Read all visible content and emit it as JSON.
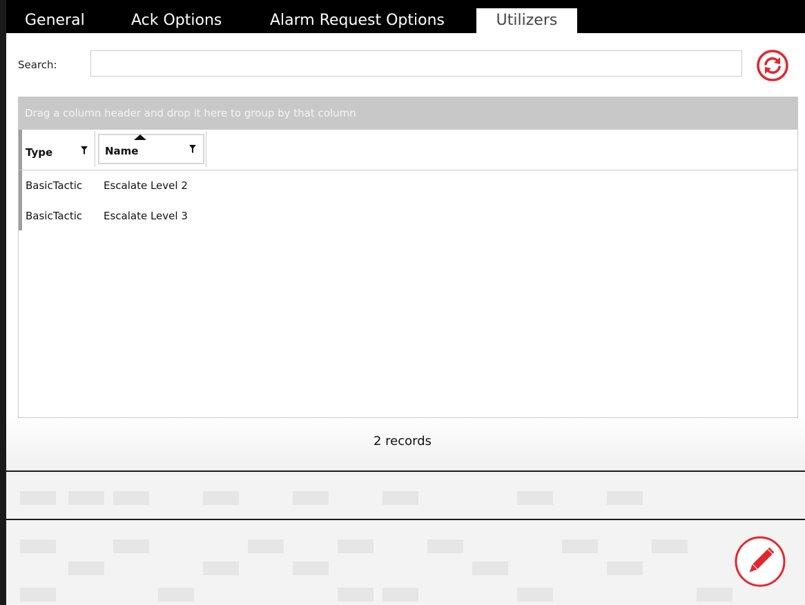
{
  "tabs": [
    {
      "label": "General",
      "active": false
    },
    {
      "label": "Ack Options",
      "active": false
    },
    {
      "label": "Alarm Request Options",
      "active": false
    },
    {
      "label": "Utilizers",
      "active": true
    }
  ],
  "search": {
    "label": "Search:",
    "value": "",
    "placeholder": ""
  },
  "grid": {
    "group_panel_text": "Drag a column header and drop it here to group by that column",
    "columns": [
      {
        "label": "Type",
        "sorted": false
      },
      {
        "label": "Name",
        "sorted": true,
        "sort_direction": "ascending"
      }
    ],
    "rows": [
      {
        "type": "BasicTactic",
        "name": "Escalate Level 2"
      },
      {
        "type": "BasicTactic",
        "name": "Escalate Level 3"
      }
    ],
    "record_count": "2 records"
  },
  "icons": {
    "refresh": "refresh-icon",
    "edit": "pencil-icon",
    "filter": "filter-icon",
    "sort": "sort-ascending-icon"
  },
  "colors": {
    "accent": "#e3262d",
    "tabbar": "#000000",
    "group_panel": "#c8c8c8"
  }
}
